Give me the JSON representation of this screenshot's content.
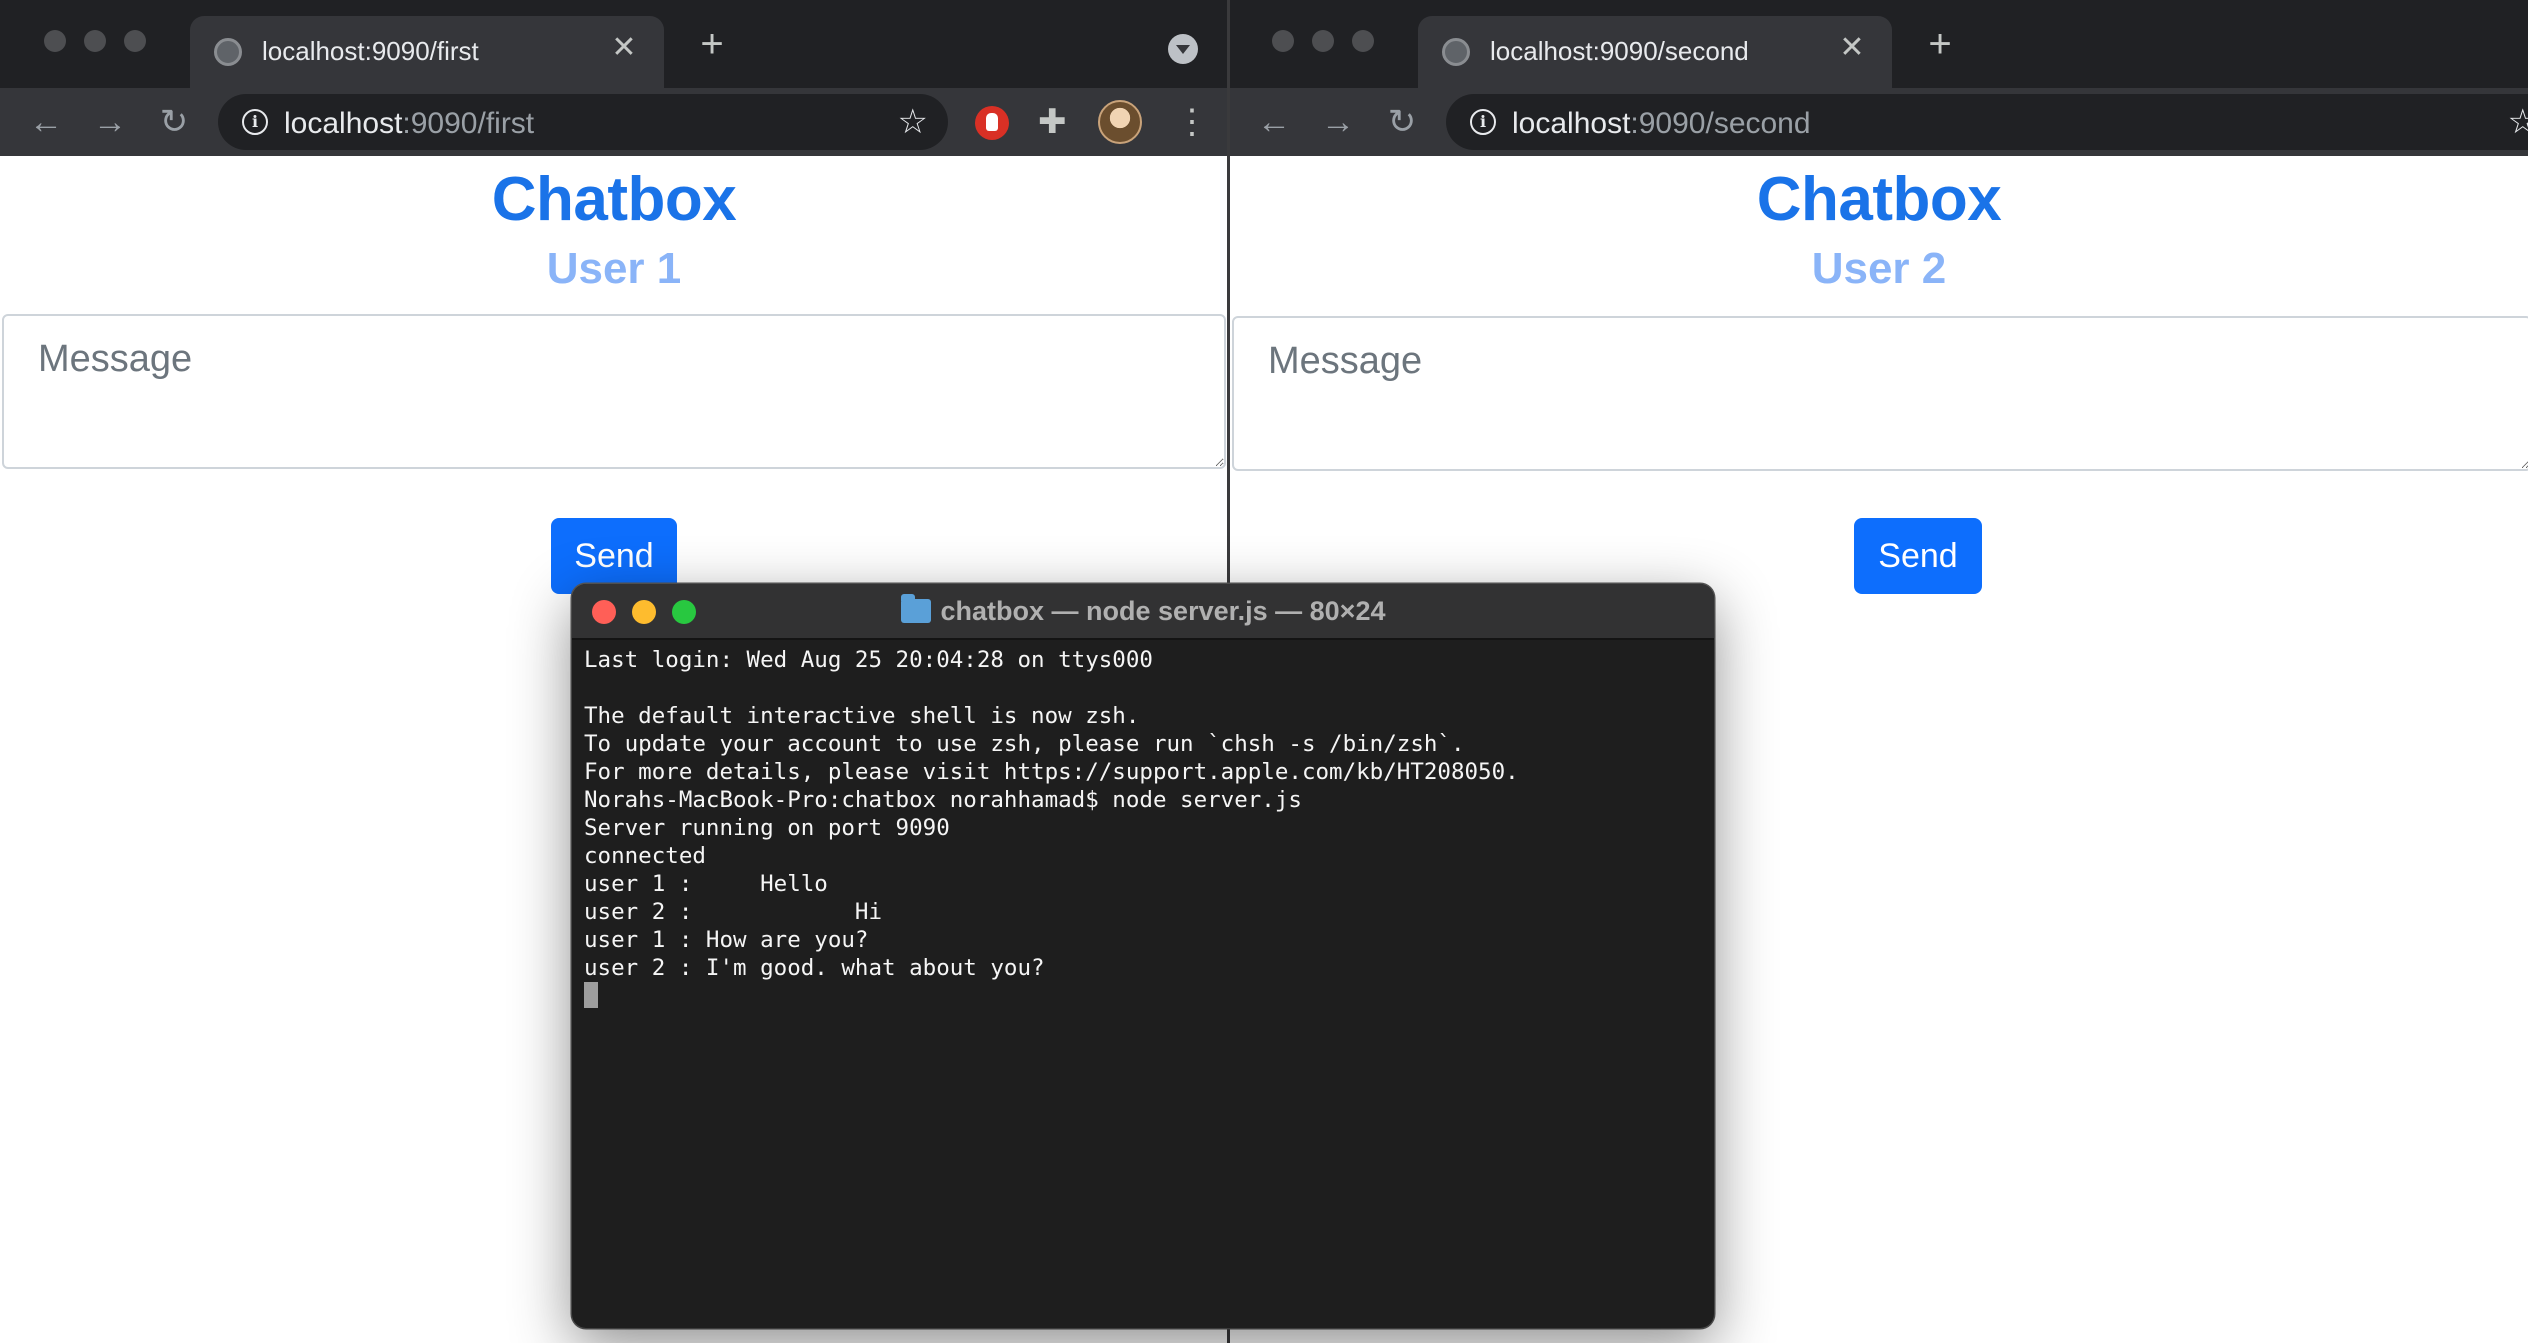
{
  "left_browser": {
    "tab_title": "localhost:9090/first",
    "url_host": "localhost",
    "url_rest": ":9090/first",
    "page_title": "Chatbox",
    "user_label": "User 1",
    "message_placeholder": "Message",
    "send_label": "Send"
  },
  "right_browser": {
    "tab_title": "localhost:9090/second",
    "url_host": "localhost",
    "url_rest": ":9090/second",
    "page_title": "Chatbox",
    "user_label": "User 2",
    "message_placeholder": "Message",
    "send_label": "Send"
  },
  "terminal": {
    "title": "chatbox — node server.js — 80×24",
    "lines": [
      "Last login: Wed Aug 25 20:04:28 on ttys000",
      "",
      "The default interactive shell is now zsh.",
      "To update your account to use zsh, please run `chsh -s /bin/zsh`.",
      "For more details, please visit https://support.apple.com/kb/HT208050.",
      "Norahs-MacBook-Pro:chatbox norahhamad$ node server.js",
      "Server running on port 9090",
      "connected",
      "user 1 :     Hello",
      "user 2 :            Hi",
      "user 1 : How are you?",
      "user 2 : I'm good. what about you?"
    ]
  },
  "icons": {
    "back": "arrow-left-icon",
    "forward": "arrow-right-icon",
    "reload": "reload-icon",
    "info": "info-icon",
    "bookmark": "star-icon",
    "extension_block": "stop-hand-icon",
    "extensions": "puzzle-icon",
    "profile": "avatar-icon",
    "menu": "kebab-menu-icon",
    "folder": "folder-icon"
  },
  "colors": {
    "heading": "#1a73e8",
    "user_label": "#8ab4f8",
    "send_button": "#0d6efd",
    "terminal_bg": "#1e1e1e"
  }
}
